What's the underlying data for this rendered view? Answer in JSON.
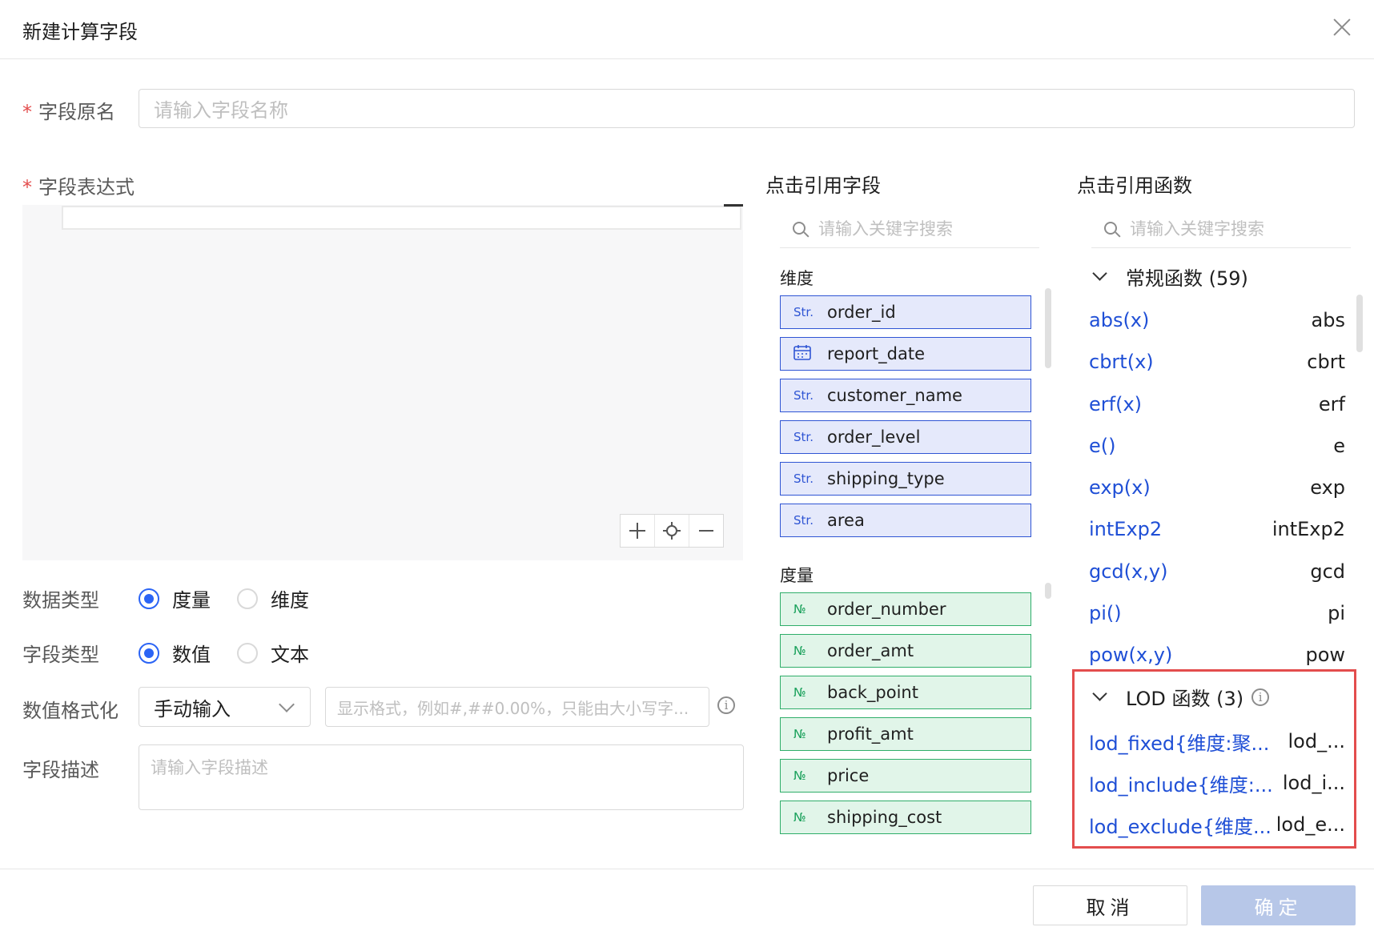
{
  "dialog": {
    "title": "新建计算字段"
  },
  "form": {
    "field_name": {
      "label": "字段原名",
      "required_mark": "*",
      "placeholder": "请输入字段名称"
    },
    "expression": {
      "label": "字段表达式",
      "required_mark": "*"
    },
    "data_type": {
      "label": "数据类型",
      "options": [
        "度量",
        "维度"
      ],
      "selected": "度量"
    },
    "field_type": {
      "label": "字段类型",
      "options": [
        "数值",
        "文本"
      ],
      "selected": "数值"
    },
    "number_format": {
      "label": "数值格式化",
      "select_value": "手动输入",
      "placeholder": "显示格式，例如#,##0.00%，只能由大小写字..."
    },
    "description": {
      "label": "字段描述",
      "placeholder": "请输入字段描述"
    }
  },
  "fields_panel": {
    "title": "点击引用字段",
    "search_placeholder": "请输入关键字搜索",
    "dimension_group": "维度",
    "dimensions": [
      {
        "icon": "Str.",
        "name": "order_id"
      },
      {
        "icon": "calendar-icon",
        "name": "report_date"
      },
      {
        "icon": "Str.",
        "name": "customer_name"
      },
      {
        "icon": "Str.",
        "name": "order_level"
      },
      {
        "icon": "Str.",
        "name": "shipping_type"
      },
      {
        "icon": "Str.",
        "name": "area"
      }
    ],
    "measure_group": "度量",
    "measures": [
      {
        "icon": "№",
        "name": "order_number"
      },
      {
        "icon": "№",
        "name": "order_amt"
      },
      {
        "icon": "№",
        "name": "back_point"
      },
      {
        "icon": "№",
        "name": "profit_amt"
      },
      {
        "icon": "№",
        "name": "price"
      },
      {
        "icon": "№",
        "name": "shipping_cost"
      }
    ]
  },
  "functions_panel": {
    "title": "点击引用函数",
    "search_placeholder": "请输入关键字搜索",
    "regular_group": "常规函数 (59)",
    "regular": [
      {
        "name": "abs(x)",
        "alias": "abs"
      },
      {
        "name": "cbrt(x)",
        "alias": "cbrt"
      },
      {
        "name": "erf(x)",
        "alias": "erf"
      },
      {
        "name": "e()",
        "alias": "e"
      },
      {
        "name": "exp(x)",
        "alias": "exp"
      },
      {
        "name": "intExp2",
        "alias": "intExp2"
      },
      {
        "name": "gcd(x,y)",
        "alias": "gcd"
      },
      {
        "name": "pi()",
        "alias": "pi"
      },
      {
        "name": "pow(x,y)",
        "alias": "pow"
      }
    ],
    "lod_group": "LOD 函数 (3)",
    "lod": [
      {
        "name": "lod_fixed{维度:聚...",
        "alias": "lod_..."
      },
      {
        "name": "lod_include{维度:...",
        "alias": "lod_i..."
      },
      {
        "name": "lod_exclude{维度...",
        "alias": "lod_e..."
      }
    ]
  },
  "footer": {
    "cancel": "取消",
    "ok": "确定"
  },
  "colors": {
    "accent": "#2b64f5",
    "link": "#1f4fd6",
    "required": "#e34d4d",
    "highlight": "#e34d4d",
    "ok_disabled": "#b7c7e8"
  }
}
